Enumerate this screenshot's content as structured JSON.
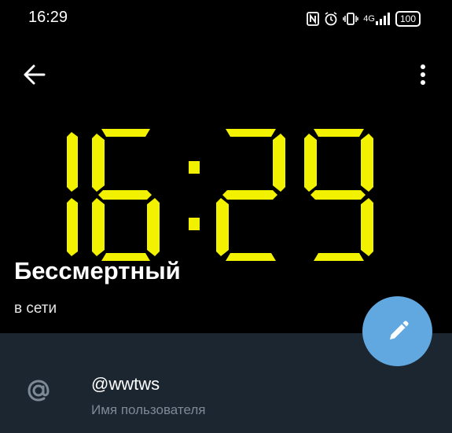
{
  "status_bar": {
    "time": "16:29",
    "icons": [
      "nfc-icon",
      "alarm-icon",
      "vibrate-icon",
      "signal-icon"
    ],
    "network_label": "4G",
    "battery": "100"
  },
  "app_bar": {
    "back_icon": "arrow-left-icon",
    "menu_icon": "more-vertical-icon"
  },
  "avatar": {
    "clock_text": "16:29",
    "digit_color": "#f2f200"
  },
  "profile": {
    "name": "Бессмертный",
    "status": "в сети"
  },
  "info": {
    "username": "@wwtws",
    "username_caption": "Имя пользователя"
  },
  "colors": {
    "panel": "#1c2630",
    "fab": "#62a8e0",
    "caption": "#7d8995"
  }
}
